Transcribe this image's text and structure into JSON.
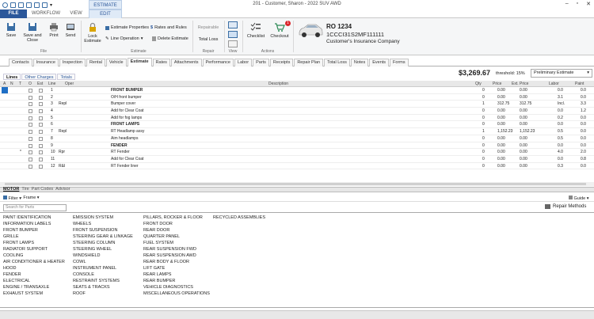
{
  "window": {
    "title": "201 - Customer, Sharon - 2022 SUV AWD",
    "context_tab": "ESTIMATE"
  },
  "ribbon_tabs": [
    "FILE",
    "WORKFLOW",
    "VIEW",
    "EDIT"
  ],
  "ribbon": {
    "file_group": {
      "save": "Save",
      "save_close": "Save and Close",
      "print": "Print",
      "send": "Send",
      "label": "File"
    },
    "estimate_group": {
      "lock": "Lock Estimate",
      "properties": "Estimate Properties",
      "line_operation": "Line Operation",
      "rates_rules": "Rates and Rules",
      "delete": "Delete Estimate",
      "label": "Estimate"
    },
    "repair_group": {
      "repairable": "Repairable",
      "total_loss": "Total Loss",
      "label": "Repair"
    },
    "view_group": {
      "label": "View"
    },
    "actions_group": {
      "checklist": "Checklist",
      "checkout": "Checkout",
      "badge": "1",
      "label": "Actions"
    }
  },
  "ro": {
    "number": "RO 1234",
    "vin": "1CCCI31S2MF111111",
    "insurer": "Customer's Insurance Company"
  },
  "subtabs": [
    "Contacts",
    "Insurance",
    "Inspection",
    "Rental",
    "Vehicle",
    "Estimate",
    "Rates",
    "Attachments",
    "Performance",
    "Labor",
    "Parts",
    "Receipts",
    "Repair Plan",
    "Total Loss",
    "Notes",
    "Events",
    "Forms"
  ],
  "estimate_tabs": [
    "Lines",
    "Other Charges",
    "Totals"
  ],
  "totals": {
    "amount": "$3,269.67",
    "threshold_label": "threshold:",
    "threshold_value": "15%",
    "estimate_type": "Preliminary Estimate"
  },
  "grid": {
    "headers": {
      "a": "A",
      "n": "N",
      "t": "T",
      "o": "O",
      "est": "Est",
      "line": "Line",
      "oper": "Oper",
      "desc": "Description",
      "qty": "Qty",
      "price": "Price",
      "ext_price": "Ext. Price",
      "labor": "Labor",
      "paint": "Paint"
    },
    "rows": [
      {
        "line": "1",
        "oper": "",
        "desc": "FRONT BUMPER",
        "qty": "0",
        "price": "0.00",
        "ext": "0.00",
        "labor": "0.0",
        "paint": "0.0",
        "section": true
      },
      {
        "line": "2",
        "oper": "",
        "desc": "O/H front bumper",
        "qty": "0",
        "price": "0.00",
        "ext": "0.00",
        "labor": "3.1",
        "paint": "0.0"
      },
      {
        "line": "3",
        "oper": "Repl",
        "desc": "Bumper cover",
        "qty": "1",
        "price": "312.75",
        "ext": "312.75",
        "labor": "Incl.",
        "paint": "3.3"
      },
      {
        "line": "4",
        "oper": "",
        "desc": "Add for Clear Coat",
        "qty": "0",
        "price": "0.00",
        "ext": "0.00",
        "labor": "0.0",
        "paint": "1.2"
      },
      {
        "line": "5",
        "oper": "",
        "desc": "Add for fog lamps",
        "qty": "0",
        "price": "0.00",
        "ext": "0.00",
        "labor": "0.2",
        "paint": "0.0"
      },
      {
        "line": "6",
        "oper": "",
        "desc": "FRONT LAMPS",
        "qty": "0",
        "price": "0.00",
        "ext": "0.00",
        "labor": "0.0",
        "paint": "0.0",
        "section": true
      },
      {
        "line": "7",
        "oper": "Repl",
        "desc": "RT Headlamp assy",
        "qty": "1",
        "price": "1,152.23",
        "ext": "1,152.23",
        "labor": "0.5",
        "paint": "0.0"
      },
      {
        "line": "8",
        "oper": "",
        "desc": "Aim headlamps",
        "qty": "0",
        "price": "0.00",
        "ext": "0.00",
        "labor": "0.5",
        "paint": "0.0"
      },
      {
        "line": "9",
        "oper": "",
        "desc": "FENDER",
        "qty": "0",
        "price": "0.00",
        "ext": "0.00",
        "labor": "0.0",
        "paint": "0.0",
        "section": true
      },
      {
        "line": "10",
        "oper": "Rpr",
        "desc": "RT Fender",
        "qty": "0",
        "price": "0.00",
        "ext": "0.00",
        "labor": "4.0",
        "paint": "2.0",
        "mark": "*"
      },
      {
        "line": "11",
        "oper": "",
        "desc": "Add for Clear Coat",
        "qty": "0",
        "price": "0.00",
        "ext": "0.00",
        "labor": "0.0",
        "paint": "0.8"
      },
      {
        "line": "12",
        "oper": "R&I",
        "desc": "RT Fender liner",
        "qty": "0",
        "price": "0.00",
        "ext": "0.00",
        "labor": "0.3",
        "paint": "0.0"
      }
    ]
  },
  "bottom_tabs": [
    "MOTOR",
    "Tire",
    "Part Codes",
    "Advisor"
  ],
  "filter": {
    "filter_label": "Filter",
    "frame_label": "Frame",
    "guide_label": "Guide",
    "search_placeholder": "Search for Parts",
    "repair_methods": "Repair Methods"
  },
  "parts_columns": [
    [
      "PAINT IDENTIFICATION",
      "INFORMATION LABELS",
      "FRONT BUMPER",
      "GRILLE",
      "FRONT LAMPS",
      "RADIATOR SUPPORT",
      "COOLING",
      "AIR CONDITIONER & HEATER",
      "HOOD",
      "FENDER",
      "ELECTRICAL",
      "ENGINE / TRANSAXLE",
      "EXHAUST SYSTEM"
    ],
    [
      "EMISSION SYSTEM",
      "WHEELS",
      "FRONT SUSPENSION",
      "STEERING GEAR & LINKAGE",
      "STEERING COLUMN",
      "STEERING WHEEL",
      "WINDSHIELD",
      "COWL",
      "INSTRUMENT PANEL",
      "CONSOLE",
      "RESTRAINT SYSTEMS",
      "SEATS & TRACKS",
      "ROOF"
    ],
    [
      "PILLARS, ROCKER & FLOOR",
      "FRONT DOOR",
      "REAR DOOR",
      "QUARTER PANEL",
      "FUEL SYSTEM",
      "REAR SUSPENSION FWD",
      "REAR SUSPENSION AWD",
      "REAR BODY & FLOOR",
      "LIFT GATE",
      "REAR LAMPS",
      "REAR BUMPER",
      "VEHICLE DIAGNOSTICS",
      "MISCELLANEOUS OPERATIONS"
    ],
    [
      "RECYCLED ASSEMBLIES"
    ]
  ]
}
